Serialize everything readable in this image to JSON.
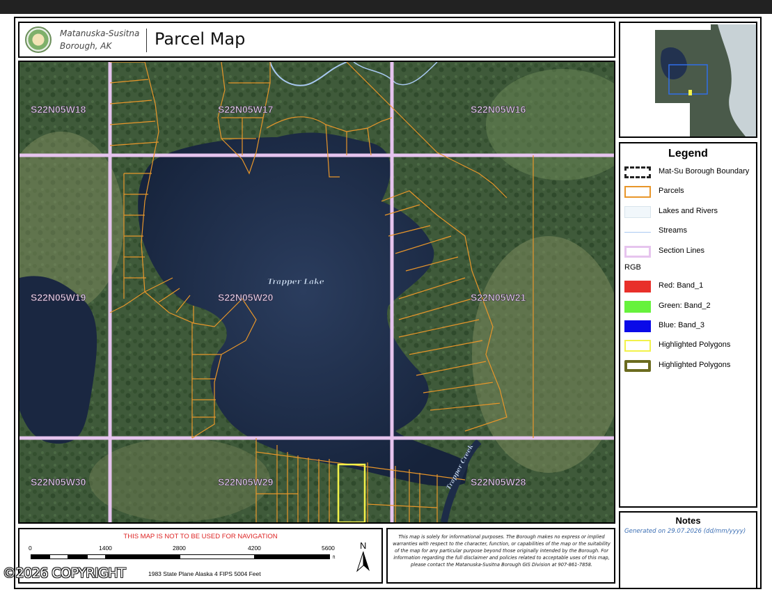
{
  "header": {
    "org_line1": "Matanuska-Susitna",
    "org_line2": "Borough, AK",
    "title": "Parcel Map"
  },
  "map": {
    "sections": [
      "S22N05W18",
      "S22N05W17",
      "S22N05W16",
      "S22N05W19",
      "S22N05W20",
      "S22N05W21",
      "S22N05W30",
      "S22N05W29",
      "S22N05W28"
    ],
    "water_labels": {
      "lake": "Trapper Lake",
      "creek": "Trapper Creek"
    },
    "colors": {
      "parcels": "#e8962a",
      "section_lines": "#e6c4ee",
      "highlight": "#f2f24a",
      "streams": "#a9c9f2",
      "lake": "#1d2c48"
    }
  },
  "legend": {
    "title": "Legend",
    "items": [
      {
        "label": "Mat-Su Borough Boundary",
        "swatch": "boundary"
      },
      {
        "label": "Parcels",
        "swatch": "parcels"
      },
      {
        "label": "Lakes and Rivers",
        "swatch": "lakes"
      },
      {
        "label": "Streams",
        "swatch": "streams"
      },
      {
        "label": "Section Lines",
        "swatch": "section"
      }
    ],
    "rgb_label": "RGB",
    "bands": [
      {
        "label": "Red:  Band_1",
        "color": "#e8302a"
      },
      {
        "label": "Green: Band_2",
        "color": "#66f23c"
      },
      {
        "label": "Blue:  Band_3",
        "color": "#0a0ae8"
      },
      {
        "label": "Highlighted Polygons",
        "swatch": "highlight-yellow"
      },
      {
        "label": "Highlighted Polygons",
        "swatch": "highlight-olive"
      }
    ]
  },
  "notes": {
    "title": "Notes",
    "generated": "Generated on  29.07.2026  (dd/mm/yyyy)"
  },
  "scale": {
    "warning": "THIS MAP IS NOT TO BE USED FOR NAVIGATION",
    "labels": [
      "0",
      "1400",
      "2800",
      "4200",
      "5600"
    ],
    "unit": "ft",
    "north": "N",
    "projection": "1983 State Plane Alaska 4 FIPS 5004 Feet"
  },
  "disclaimer": "This map is solely for informational purposes. The Borough makes no express or implied warranties with respect to the character, function, or capabilities of the map or the suitability of the map for any particular purpose beyond those originally intended by the Borough. For information regarding the full disclaimer and policies related to acceptable uses of this map, please contact the Matanuska-Susitna Borough GIS Division at 907-861-7858.",
  "watermark": "©2026 COPYRIGHT"
}
